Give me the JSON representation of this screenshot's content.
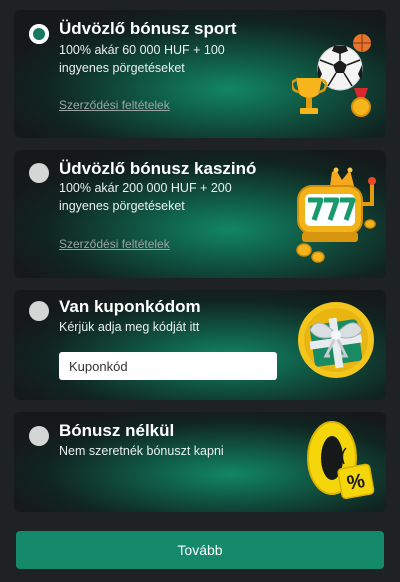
{
  "options": [
    {
      "title": "Üdvözlő bónusz sport",
      "description": "100% akár 60 000 HUF + 100 ingyenes pörgetéseket",
      "terms_label": "Szerződési feltételek",
      "selected": true,
      "icon": "sport-trophy-ball-icon"
    },
    {
      "title": "Üdvözlő bónusz kaszinó",
      "description": "100% akár 200 000 HUF + 200 ingyenes pörgetéseket",
      "terms_label": "Szerződési feltételek",
      "selected": false,
      "icon": "slot-machine-777-icon"
    },
    {
      "title": "Van kuponkódom",
      "description": "Kérjük adja meg kódját itt",
      "input_placeholder": "Kuponkód",
      "selected": false,
      "icon": "gift-box-icon"
    },
    {
      "title": "Bónusz nélkül",
      "description": "Nem szeretnék bónuszt kapni",
      "badge_text": "%",
      "selected": false,
      "icon": "zero-percent-icon"
    }
  ],
  "continue_label": "Tovább",
  "colors": {
    "accent": "#148a6b",
    "card_bg": "#15191a",
    "page_bg": "#1f2223",
    "radio_unselected": "#d4d6d6"
  }
}
